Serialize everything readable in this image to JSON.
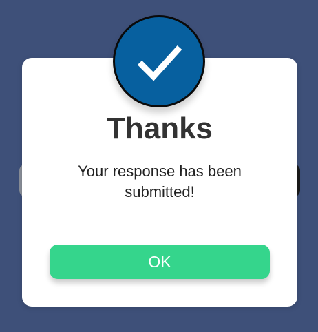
{
  "dialog": {
    "title": "Thanks",
    "message": "Your response has been submitted!",
    "ok_label": "OK",
    "icon": "checkmark-icon"
  },
  "colors": {
    "background": "#3e5079",
    "dialog_bg": "#ffffff",
    "badge": "#07609f",
    "button": "#35d58c",
    "button_text": "#ffffff",
    "title_text": "#333333"
  }
}
